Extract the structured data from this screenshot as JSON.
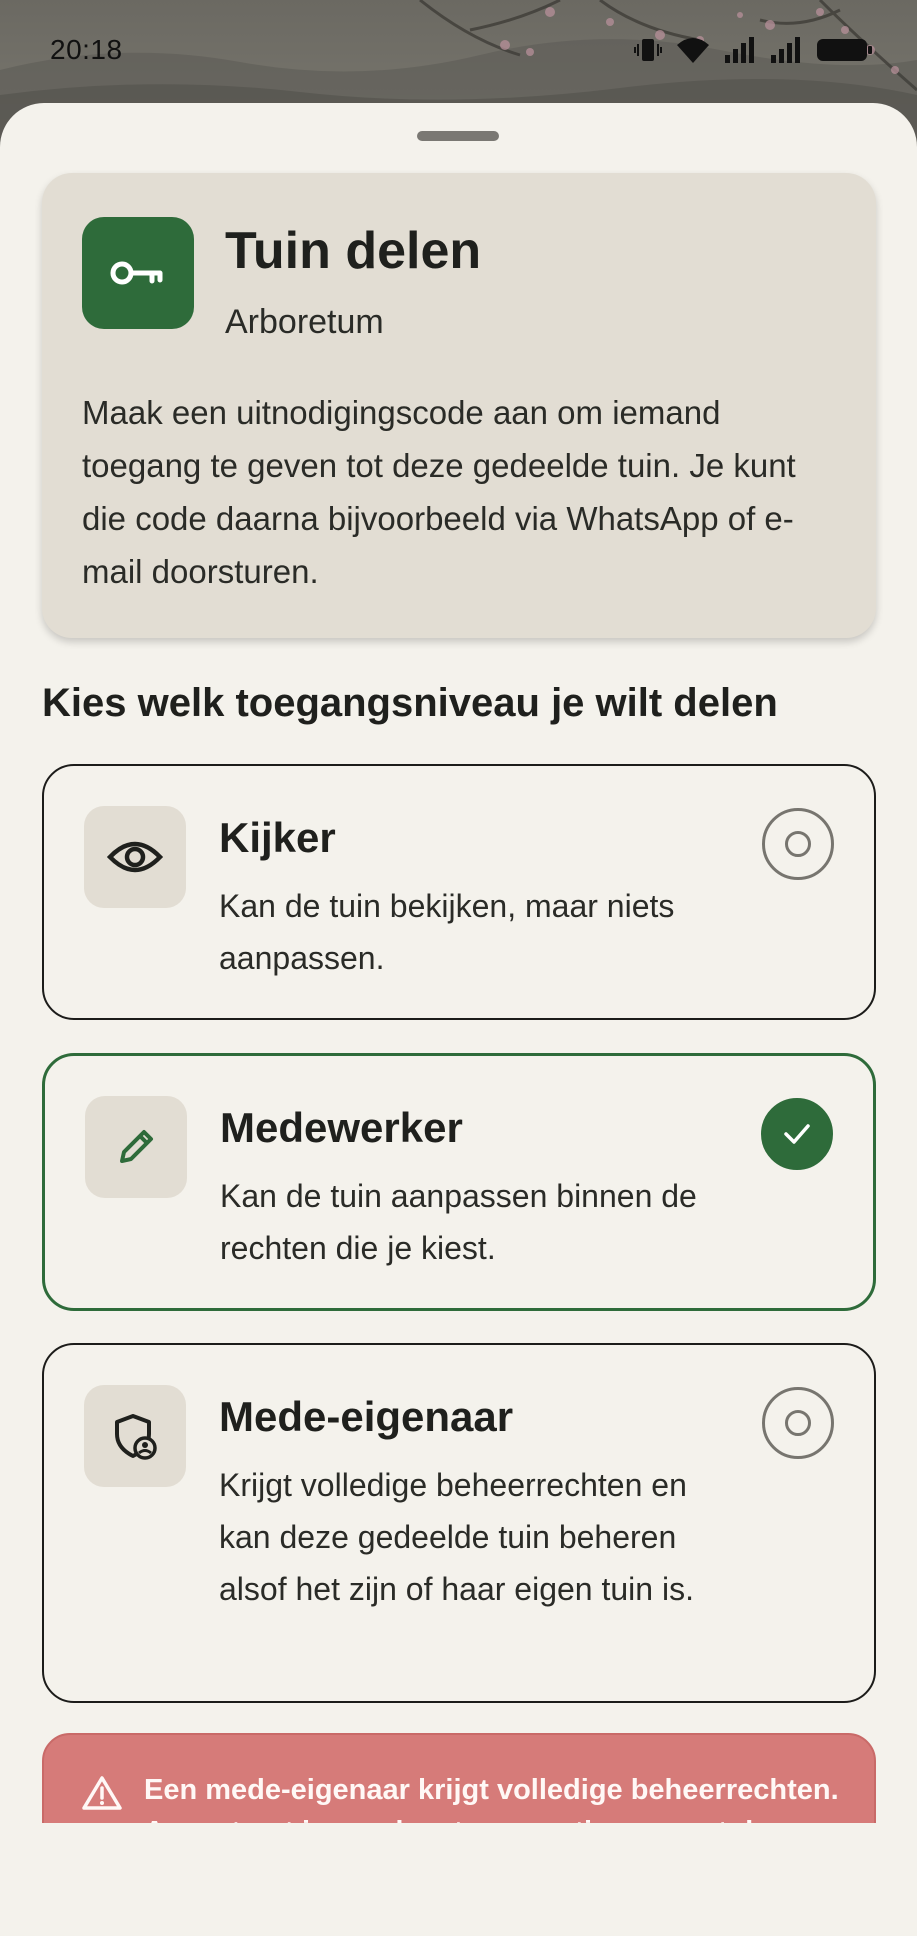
{
  "status_bar": {
    "time": "20:18"
  },
  "sheet": {
    "header": {
      "icon": "key-icon",
      "title": "Tuin delen",
      "subtitle": "Arboretum",
      "description": "Maak een uitnodigingscode aan om iemand toegang te geven tot deze gedeelde tuin. Je kunt die code daarna bijvoorbeeld via WhatsApp of e-mail doorsturen."
    },
    "section_heading": "Kies welk toegangsniveau je wilt delen",
    "options": [
      {
        "icon": "eye-icon",
        "title": "Kijker",
        "description": "Kan de tuin bekijken, maar niets aanpassen.",
        "selected": false
      },
      {
        "icon": "pencil-icon",
        "title": "Medewerker",
        "description": "Kan de tuin aanpassen binnen de rechten die je kiest.",
        "selected": true
      },
      {
        "icon": "shield-user-icon",
        "title": "Mede-eigenaar",
        "description": "Krijgt volledige beheerrechten en kan deze gedeelde tuin beheren alsof het zijn of haar eigen tuin is.",
        "selected": false
      }
    ],
    "warning": {
      "icon": "warning-icon",
      "text": "Een mede-eigenaar krijgt volledige beheerrechten. Accepteert iemand met een gratis account deze uitnodiging, dan wordt die"
    }
  },
  "colors": {
    "accent_green": "#2e6b3a",
    "sheet_background": "#f4f2ec",
    "card_background": "#e2ddd3",
    "warning_background": "#d67b79"
  }
}
